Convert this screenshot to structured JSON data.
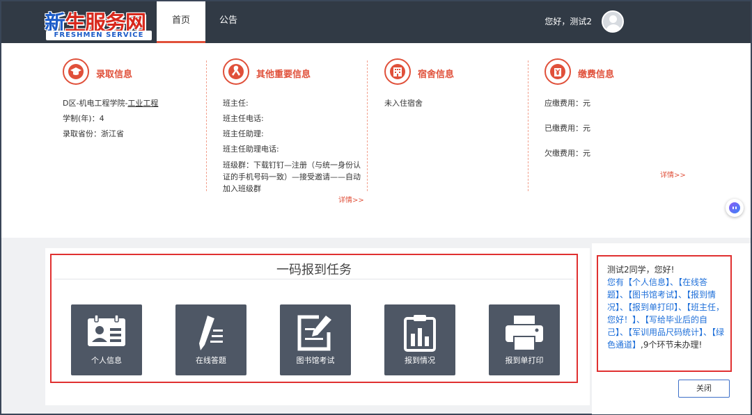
{
  "header": {
    "logo_main_blue": "新",
    "logo_main_red": "生服务网",
    "logo_sub": "FRESHMEN SERVICE",
    "nav": [
      "首页",
      "公告"
    ],
    "greeting": "您好，测试2"
  },
  "admission": {
    "title": "录取信息",
    "college": "D区-机电工程学院-",
    "major": "工业工程",
    "duration": "学制(年)：4",
    "province": "录取省份：浙江省"
  },
  "other": {
    "title": "其他重要信息",
    "lines": [
      "班主任:",
      "班主任电话:",
      "班主任助理:",
      "班主任助理电话:"
    ],
    "group": "班级群：下载钉钉—注册（与统一身份认证的手机号码一致）—接受邀请——自动加入班级群",
    "more": "详情>>"
  },
  "dorm": {
    "title": "宿舍信息",
    "status": "未入住宿舍"
  },
  "fee": {
    "title": "缴费信息",
    "lines": [
      "应缴费用：元",
      "已缴费用：元",
      "欠缴费用：元"
    ],
    "more": "详情>>"
  },
  "tasks": {
    "title": "一码报到任务",
    "items": [
      "个人信息",
      "在线答题",
      "图书馆考试",
      "报到情况",
      "报到单打印"
    ]
  },
  "message": {
    "greeting": "测试2同学，您好!",
    "prefix": "您有",
    "links": "【个人信息】、【在线答题】、【图书馆考试】、【报到情况】、【报到单打印】、【班主任，您好！】、【写给毕业后的自己】、【军训用品尺码统计】、【绿色通道】",
    "suffix": ",9个环节未办理!",
    "close": "关闭"
  },
  "colors": {
    "accent": "#e0503a",
    "header_bg": "#313a45",
    "card_bg": "#4e5765",
    "highlight_border": "#e03030",
    "link_blue": "#1e6fd9"
  }
}
